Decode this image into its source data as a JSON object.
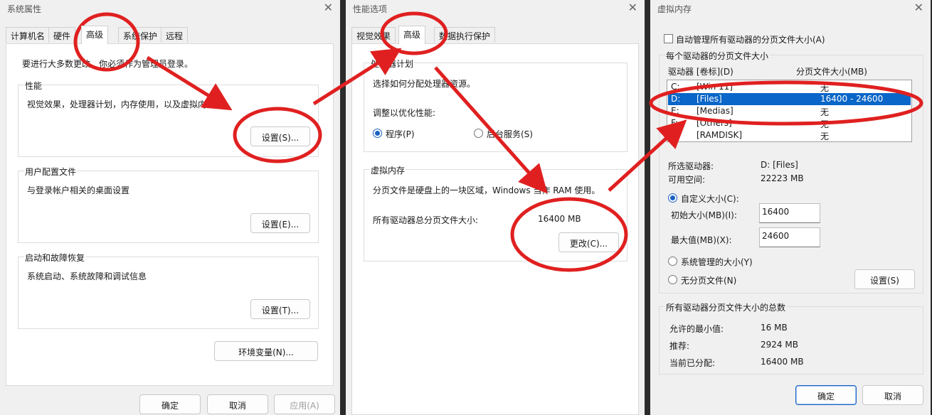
{
  "system_props": {
    "title": "系统属性",
    "tabs": [
      "计算机名",
      "硬件",
      "高级",
      "系统保护",
      "远程"
    ],
    "admin_note": "要进行大多数更改，你必须作为管理员登录。",
    "performance": {
      "title": "性能",
      "desc": "视觉效果，处理器计划，内存使用，以及虚拟内存",
      "button": "设置(S)..."
    },
    "user_profiles": {
      "title": "用户配置文件",
      "desc": "与登录帐户相关的桌面设置",
      "button": "设置(E)..."
    },
    "startup_recovery": {
      "title": "启动和故障恢复",
      "desc": "系统启动、系统故障和调试信息",
      "button": "设置(T)..."
    },
    "env_button": "环境变量(N)...",
    "ok": "确定",
    "cancel": "取消",
    "apply": "应用(A)"
  },
  "perf_options": {
    "title": "性能选项",
    "tabs": [
      "视觉效果",
      "高级",
      "数据执行保护"
    ],
    "processor": {
      "title": "处理器计划",
      "desc": "选择如何分配处理器资源。",
      "adjust_label": "调整以优化性能:",
      "opt_programs": "程序(P)",
      "opt_services": "后台服务(S)"
    },
    "vm": {
      "title": "虚拟内存",
      "desc": "分页文件是硬盘上的一块区域，Windows 当作 RAM 使用。",
      "total_label": "所有驱动器总分页文件大小:",
      "total_value": "16400 MB",
      "change_button": "更改(C)..."
    }
  },
  "virtual_memory": {
    "title": "虚拟内存",
    "auto_manage": "自动管理所有驱动器的分页文件大小(A)",
    "per_drive_title": "每个驱动器的分页文件大小",
    "col_drive": "驱动器 [卷标](D)",
    "col_size": "分页文件大小(MB)",
    "drives": [
      {
        "letter": "C:",
        "label": "[Win 11]",
        "size": "无"
      },
      {
        "letter": "D:",
        "label": "[Files]",
        "size": "16400 - 24600"
      },
      {
        "letter": "E:",
        "label": "[Medias]",
        "size": "无"
      },
      {
        "letter": "F:",
        "label": "[Others]",
        "size": "无"
      },
      {
        "letter": "R:",
        "label": "[RAMDISK]",
        "size": "无"
      }
    ],
    "selected_drive_label": "所选驱动器:",
    "selected_drive_value": "D:  [Files]",
    "free_space_label": "可用空间:",
    "free_space_value": "22223 MB",
    "custom_size": "自定义大小(C):",
    "initial_label": "初始大小(MB)(I):",
    "initial_value": "16400",
    "max_label": "最大值(MB)(X):",
    "max_value": "24600",
    "system_managed": "系统管理的大小(Y)",
    "no_paging": "无分页文件(N)",
    "set_button": "设置(S)",
    "totals_title": "所有驱动器分页文件大小的总数",
    "min_label": "允许的最小值:",
    "min_value": "16 MB",
    "recommended_label": "推荐:",
    "recommended_value": "2924 MB",
    "allocated_label": "当前已分配:",
    "allocated_value": "16400 MB",
    "ok": "确定",
    "cancel": "取消"
  },
  "annotation_color": "#e02020"
}
